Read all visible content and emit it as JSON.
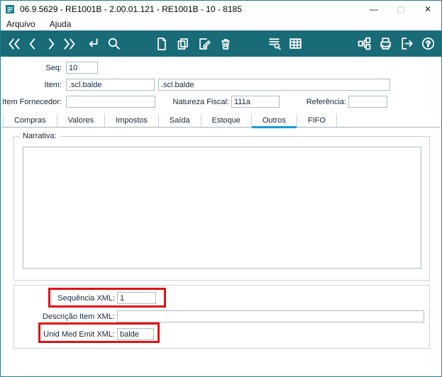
{
  "window": {
    "title": "06.9.5629 - RE1001B - 2.00.01.121 - RE1001B - 10 - 8185",
    "controls": {
      "minimize": "—",
      "maximize": "▢",
      "close": "✕"
    }
  },
  "menu": {
    "items": [
      {
        "label": "Arquivo"
      },
      {
        "label": "Ajuda"
      }
    ]
  },
  "toolbar": {
    "icons": [
      "first-record-icon",
      "previous-record-icon",
      "next-record-icon",
      "last-record-icon",
      "confirm-enter-icon",
      "search-icon",
      "new-document-icon",
      "copy-document-icon",
      "edit-document-icon",
      "delete-icon",
      "query-browse-icon",
      "table-grid-icon",
      "related-programs-icon",
      "print-icon",
      "exit-icon",
      "help-icon"
    ]
  },
  "form": {
    "seq": {
      "label": "Seq:",
      "value": "10"
    },
    "item": {
      "label": "Item:",
      "code": ".scl.balde",
      "description": ".scl.balde"
    },
    "item_fornecedor": {
      "label": "Item Fornecedor:",
      "value": ""
    },
    "natureza_fiscal": {
      "label": "Natureza Fiscal:",
      "value": "111a"
    },
    "referencia": {
      "label": "Referência:",
      "value": ""
    }
  },
  "tabs": {
    "items": [
      {
        "label": "Compras",
        "active": false
      },
      {
        "label": "Valores",
        "active": false
      },
      {
        "label": "Impostos",
        "active": false
      },
      {
        "label": "Saída",
        "active": false
      },
      {
        "label": "Estoque",
        "active": false
      },
      {
        "label": "Outros",
        "active": true
      },
      {
        "label": "FIFO",
        "active": false
      }
    ]
  },
  "outros_tab": {
    "narrativa": {
      "legend": "Narrativa:",
      "value": ""
    },
    "sequencia_xml": {
      "label": "Sequência XML:",
      "value": "1"
    },
    "descricao_item_xml": {
      "label": "Descrição Item XML:",
      "value": ""
    },
    "unid_med_emit_xml": {
      "label": "Unid Med Emit XML:",
      "value": "balde"
    }
  },
  "annotations": {
    "color": "#e01212",
    "highlighted_fields": [
      "sequencia_xml",
      "unid_med_emit_xml"
    ]
  },
  "colors": {
    "toolbar_bg": "#186b77",
    "tab_active_underline": "#1899d6"
  }
}
